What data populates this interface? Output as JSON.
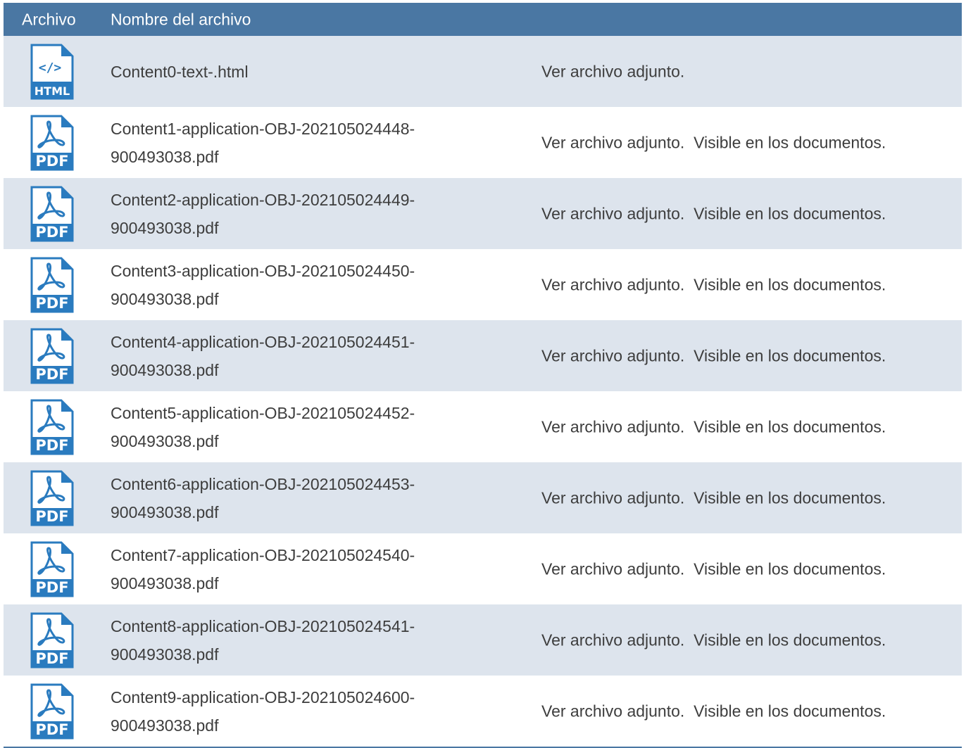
{
  "header": {
    "col_archivo": "Archivo",
    "col_nombre": "Nombre del archivo"
  },
  "colors": {
    "header_bg": "#4a77a3",
    "row_shade": "#dde4ed",
    "icon_blue": "#2a7bbf"
  },
  "rows": [
    {
      "icon": "html-file-icon",
      "icon_label": "HTML",
      "name_line1": "Content0-text-.html",
      "name_line2": "",
      "description": "Ver archivo adjunto."
    },
    {
      "icon": "pdf-file-icon",
      "icon_label": "PDF",
      "name_line1": "Content1-application-OBJ-202105024448-",
      "name_line2": "900493038.pdf",
      "description": "Ver archivo adjunto.  Visible en los documentos."
    },
    {
      "icon": "pdf-file-icon",
      "icon_label": "PDF",
      "name_line1": "Content2-application-OBJ-202105024449-",
      "name_line2": "900493038.pdf",
      "description": "Ver archivo adjunto.  Visible en los documentos."
    },
    {
      "icon": "pdf-file-icon",
      "icon_label": "PDF",
      "name_line1": "Content3-application-OBJ-202105024450-",
      "name_line2": "900493038.pdf",
      "description": "Ver archivo adjunto.  Visible en los documentos."
    },
    {
      "icon": "pdf-file-icon",
      "icon_label": "PDF",
      "name_line1": "Content4-application-OBJ-202105024451-",
      "name_line2": "900493038.pdf",
      "description": "Ver archivo adjunto.  Visible en los documentos."
    },
    {
      "icon": "pdf-file-icon",
      "icon_label": "PDF",
      "name_line1": "Content5-application-OBJ-202105024452-",
      "name_line2": "900493038.pdf",
      "description": "Ver archivo adjunto.  Visible en los documentos."
    },
    {
      "icon": "pdf-file-icon",
      "icon_label": "PDF",
      "name_line1": "Content6-application-OBJ-202105024453-",
      "name_line2": "900493038.pdf",
      "description": "Ver archivo adjunto.  Visible en los documentos."
    },
    {
      "icon": "pdf-file-icon",
      "icon_label": "PDF",
      "name_line1": "Content7-application-OBJ-202105024540-",
      "name_line2": "900493038.pdf",
      "description": "Ver archivo adjunto.  Visible en los documentos."
    },
    {
      "icon": "pdf-file-icon",
      "icon_label": "PDF",
      "name_line1": "Content8-application-OBJ-202105024541-",
      "name_line2": "900493038.pdf",
      "description": "Ver archivo adjunto.  Visible en los documentos."
    },
    {
      "icon": "pdf-file-icon",
      "icon_label": "PDF",
      "name_line1": "Content9-application-OBJ-202105024600-",
      "name_line2": "900493038.pdf",
      "description": "Ver archivo adjunto.  Visible en los documentos."
    }
  ]
}
